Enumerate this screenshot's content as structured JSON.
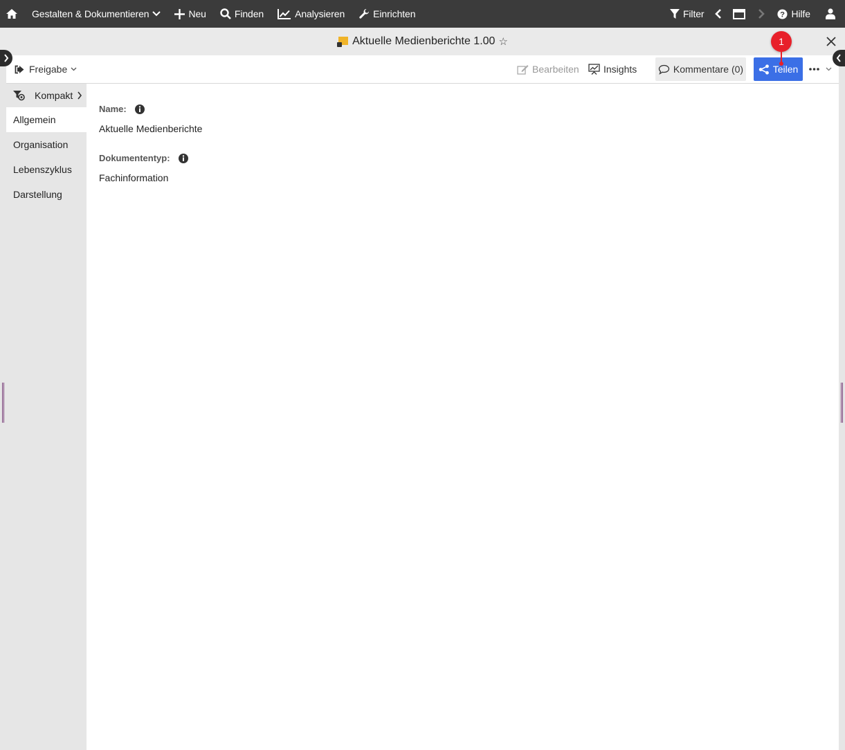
{
  "topnav": {
    "items": [
      {
        "label": "Gestalten & Dokumentieren",
        "icon": "chevron-down-icon"
      },
      {
        "label": "Neu",
        "icon": "plus-icon"
      },
      {
        "label": "Finden",
        "icon": "search-icon"
      },
      {
        "label": "Analysieren",
        "icon": "chart-line-icon"
      },
      {
        "label": "Einrichten",
        "icon": "wrench-icon"
      }
    ],
    "filter_label": "Filter",
    "help_label": "Hilfe"
  },
  "titlebar": {
    "title": "Aktuelle Medienberichte 1.00",
    "star": "☆"
  },
  "toolbar": {
    "release_label": "Freigabe",
    "edit_label": "Bearbeiten",
    "insights_label": "Insights",
    "comments_label": "Kommentare (0)",
    "share_label": "Teilen"
  },
  "leftnav": {
    "compact_label": "Kompakt",
    "items": [
      "Allgemein",
      "Organisation",
      "Lebenszyklus",
      "Darstellung"
    ],
    "active": "Allgemein"
  },
  "fields": [
    {
      "label": "Name:",
      "value": "Aktuelle Medienberichte"
    },
    {
      "label": "Dokumententyp:",
      "value": "Fachinformation"
    }
  ],
  "badge": {
    "number": "1"
  },
  "colors": {
    "topbar": "#3b3b3b",
    "share_button": "#3b6fe6",
    "badge": "#e8202a",
    "doc_icon": "#f0b429"
  }
}
